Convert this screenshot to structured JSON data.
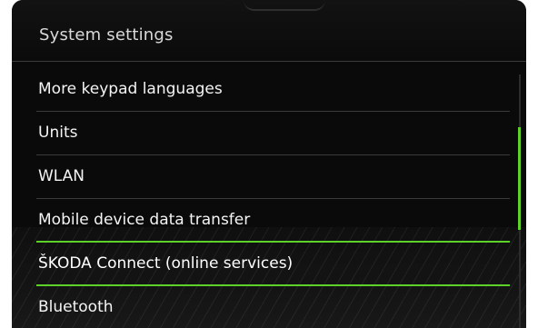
{
  "header": {
    "title": "System settings"
  },
  "list": {
    "items": [
      {
        "label": "More keypad languages"
      },
      {
        "label": "Units"
      },
      {
        "label": "WLAN"
      },
      {
        "label": "Mobile device data transfer"
      },
      {
        "label": "ŠKODA Connect (online services)"
      },
      {
        "label": "Bluetooth"
      }
    ],
    "focused_index": 4
  },
  "colors": {
    "accent": "#5bd12a",
    "background": "#0a0a0a",
    "text": "#f4f4f4"
  }
}
